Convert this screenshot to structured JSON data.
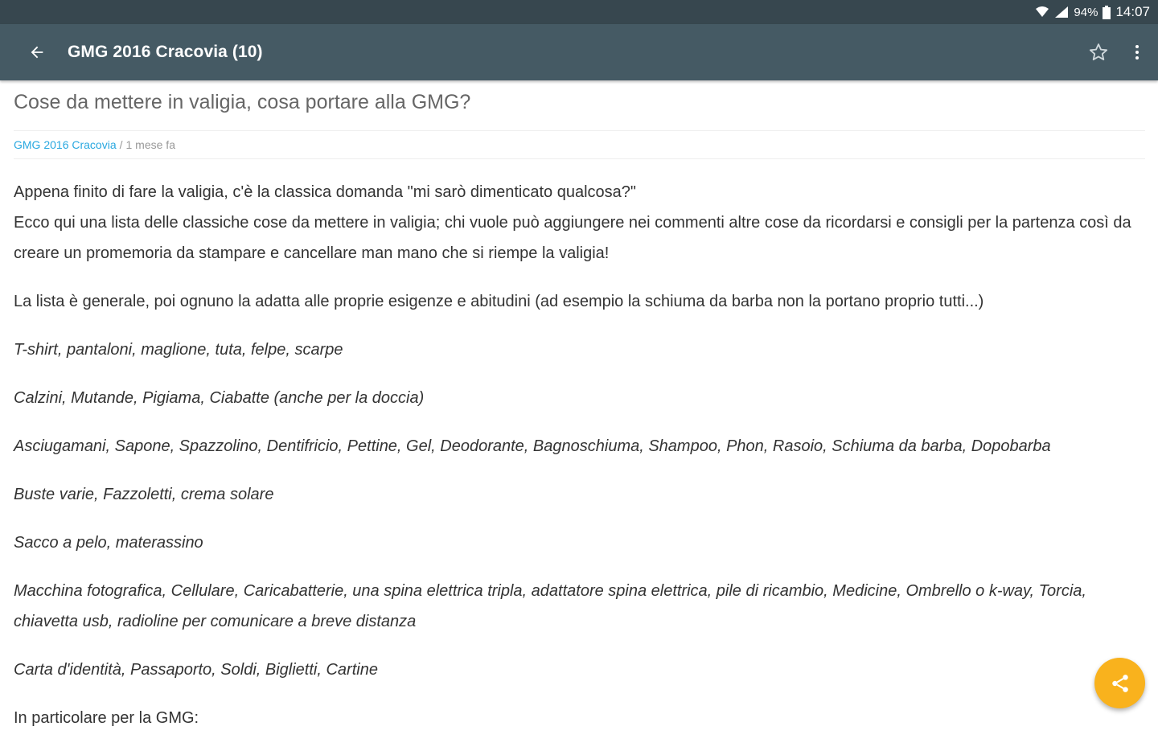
{
  "status_bar": {
    "battery": "94%",
    "time": "14:07",
    "icons": [
      "wifi-icon",
      "signal-icon",
      "battery-icon"
    ]
  },
  "app_bar": {
    "title": "GMG 2016 Cracovia (10)",
    "icons": [
      "back-arrow-icon",
      "star-outline-icon",
      "more-vert-icon"
    ]
  },
  "article": {
    "title": "Cose da mettere in valigia, cosa portare alla GMG?",
    "category": "GMG 2016 Cracovia",
    "separator": "/",
    "time_ago": "1 mese fa",
    "paragraphs": [
      "Appena finito di fare la valigia, c'è la classica domanda \"mi sarò dimenticato qualcosa?\"",
      "La lista è generale, poi ognuno la adatta alle proprie esigenze e abitudini (ad esempio la schiuma da barba non la portano proprio tutti...)"
    ],
    "intro_line2": "Ecco qui una lista delle classiche cose da mettere in valigia; chi vuole può aggiungere nei commenti altre cose da ricordarsi e consigli per la partenza così da creare un promemoria da stampare e cancellare man mano che si riempe la valigia!",
    "list_items": [
      "T-shirt, pantaloni, maglione, tuta, felpe, scarpe",
      "Calzini, Mutande, Pigiama, Ciabatte (anche per la doccia)",
      "Asciugamani, Sapone, Spazzolino, Dentifricio, Pettine, Gel, Deodorante, Bagnoschiuma, Shampoo, Phon, Rasoio, Schiuma da barba, Dopobarba",
      "Buste varie, Fazzoletti, crema solare",
      "Sacco a pelo, materassino",
      "Macchina fotografica, Cellulare, Caricabatterie, una spina elettrica tripla, adattatore spina elettrica, pile di ricambio, Medicine, Ombrello o k-way, Torcia, chiavetta usb, radioline per comunicare a breve distanza",
      "Carta d'identità, Passaporto, Soldi, Biglietti, Cartine"
    ],
    "trailing": "In particolare per la GMG:"
  },
  "fab": {
    "icon": "share-icon",
    "color": "#f9b21d"
  },
  "colors": {
    "status_bar": "#37474f",
    "app_bar": "#455a64",
    "link": "#29a8e0"
  }
}
